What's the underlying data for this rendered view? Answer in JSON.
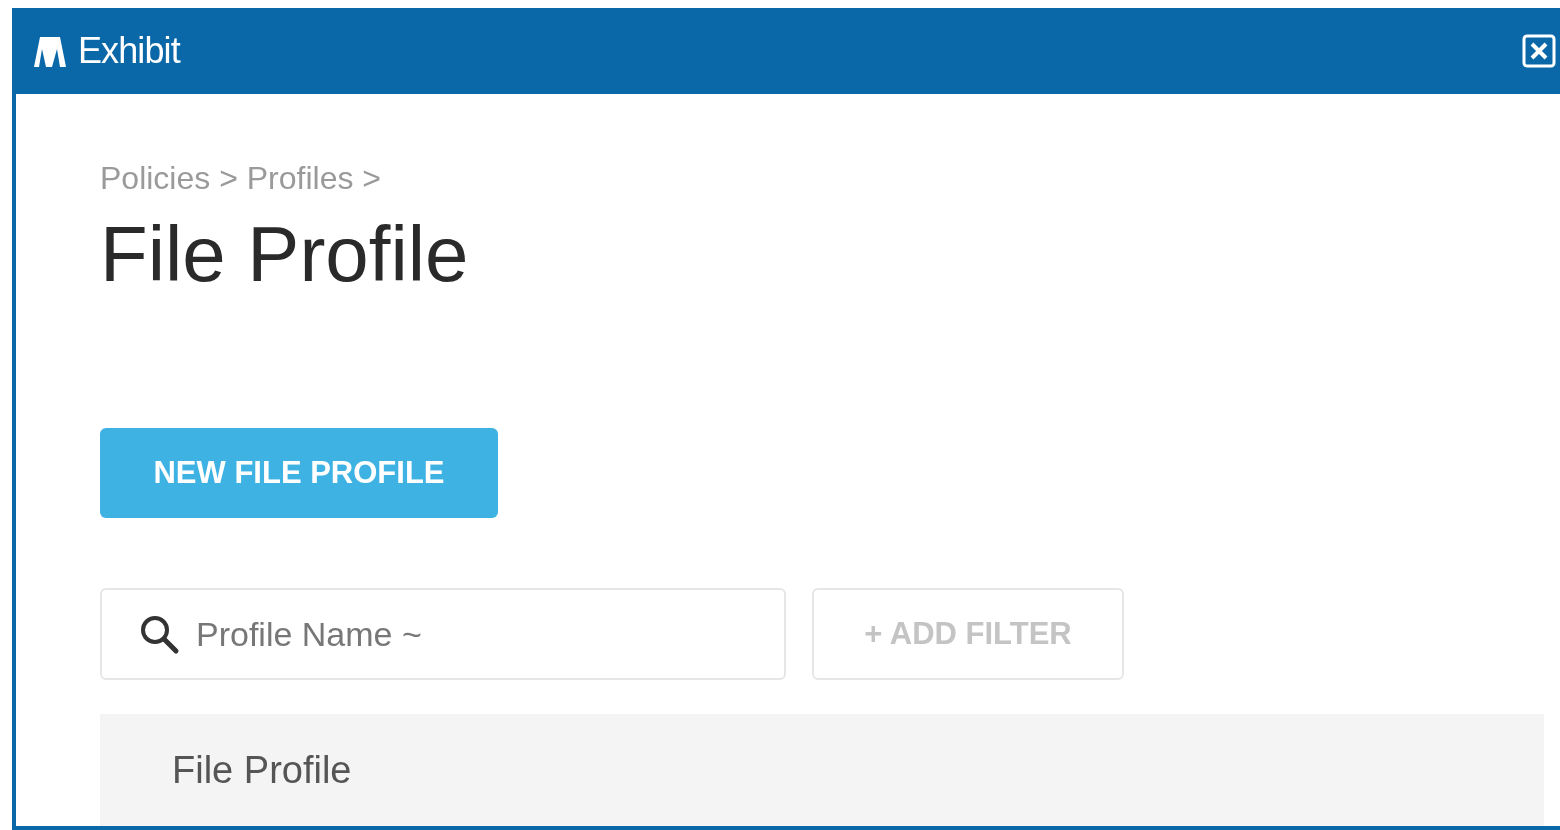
{
  "window": {
    "title": "Exhibit"
  },
  "breadcrumb": "Policies > Profiles >",
  "page_title": "File Profile",
  "new_button": "NEW FILE PROFILE",
  "search": {
    "placeholder": "Profile Name ~"
  },
  "add_filter": "+ ADD FILTER",
  "table": {
    "columns": [
      "File Profile"
    ]
  }
}
